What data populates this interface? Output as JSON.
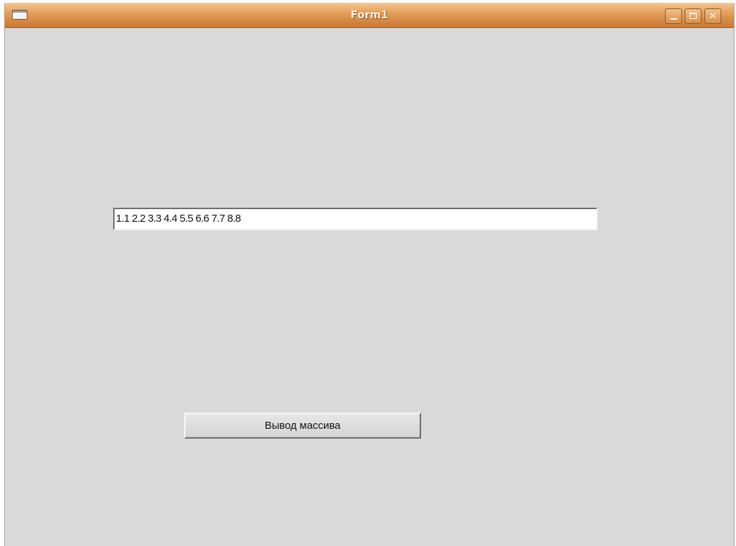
{
  "window": {
    "title": "Form1",
    "controls": {
      "minimize_icon": "minimize-icon",
      "maximize_icon": "maximize-icon",
      "close_icon": "close-icon",
      "close_glyph": "✕"
    },
    "titlebar_color": "#d68a43",
    "background_color": "#d9d9d9"
  },
  "form": {
    "textbox_value": "1.1 2.2 3.3 4.4 5.5 6.6 7.7 8.8",
    "button_label": "Вывод массива"
  }
}
